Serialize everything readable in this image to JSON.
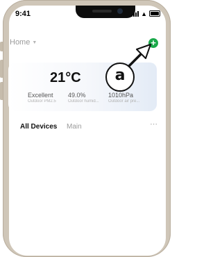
{
  "status_bar": {
    "time": "9:41"
  },
  "header": {
    "home_label": "Home"
  },
  "weather": {
    "temperature": "21°C",
    "metrics": [
      {
        "value": "Excellent",
        "caption": "Outdoor PM2.5"
      },
      {
        "value": "49.0%",
        "caption": "Outdoor humid..."
      },
      {
        "value": "1010hPa",
        "caption": "Outdoor air pre..."
      }
    ]
  },
  "tabs": [
    {
      "label": "All Devices",
      "active": true
    },
    {
      "label": "Main",
      "active": false
    }
  ],
  "annotation": {
    "label": "a"
  },
  "colors": {
    "accent_green": "#1aa94a",
    "phone_frame": "#cfc6b8"
  }
}
